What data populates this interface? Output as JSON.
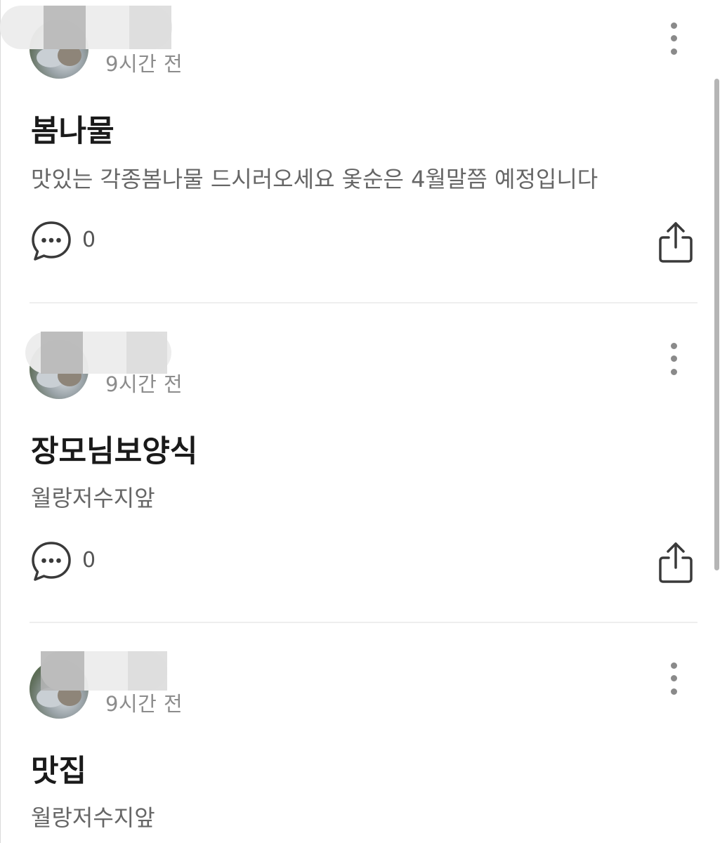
{
  "icons": {
    "comment": "speech-bubble-with-ellipsis",
    "share": "share-upload",
    "more": "vertical-ellipsis"
  },
  "colors": {
    "title": "#1a1a1a",
    "body": "#666666",
    "meta": "#8c8c8c",
    "divider": "#eeeeee"
  },
  "posts": [
    {
      "author": "",
      "time": "9시간 전",
      "title": "봄나물",
      "body": "맛있는 각종봄나물 드시러오세요 옻순은 4월말쯤 예정입니다",
      "comments": "0"
    },
    {
      "author": "",
      "time": "9시간 전",
      "title": "장모님보양식",
      "body": "월랑저수지앞",
      "comments": "0"
    },
    {
      "author": "",
      "time": "9시간 전",
      "title": "맛집",
      "body": "월랑저수지앞",
      "comments": ""
    }
  ]
}
